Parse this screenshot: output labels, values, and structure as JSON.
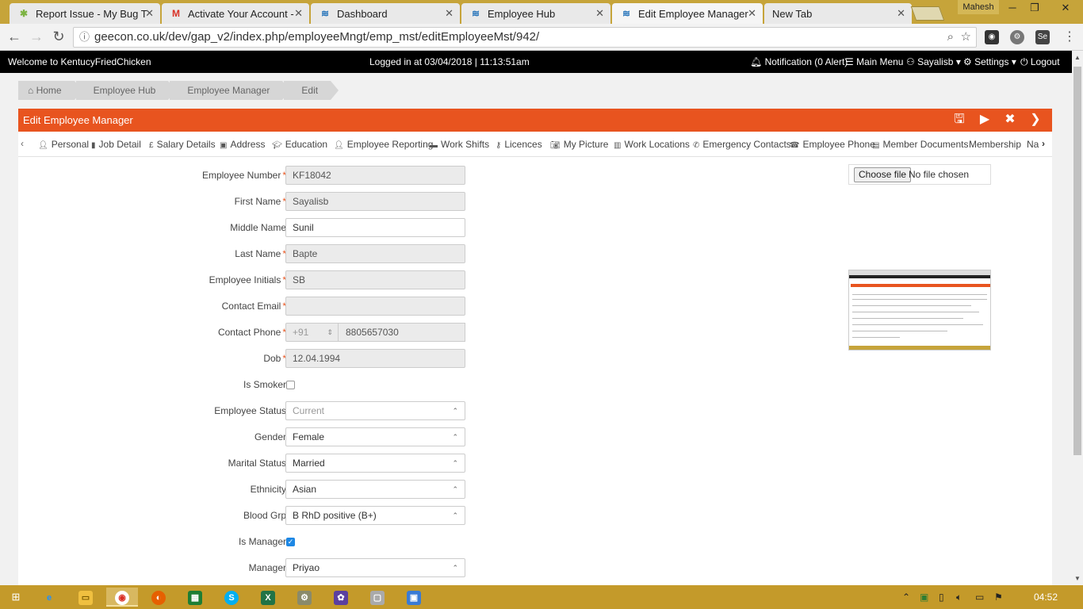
{
  "browser": {
    "tabs": [
      {
        "title": "Report Issue - My Bug Tr",
        "icon": "bug-icon",
        "color": "#7cb342"
      },
      {
        "title": "Activate Your Account -",
        "icon": "gmail-icon",
        "color": "#d93025"
      },
      {
        "title": "Dashboard",
        "icon": "app-favicon-icon",
        "color": "#1e6fb8"
      },
      {
        "title": "Employee Hub",
        "icon": "app-favicon-icon",
        "color": "#1e6fb8"
      },
      {
        "title": "Edit Employee Manager",
        "icon": "app-favicon-icon",
        "color": "#1e6fb8"
      },
      {
        "title": "New Tab",
        "icon": "",
        "color": ""
      }
    ],
    "profile_name": "Mahesh",
    "url": "geecon.co.uk/dev/gap_v2/index.php/employeeMngt/emp_mst/editEmployeeMst/942/"
  },
  "header": {
    "welcome": "Welcome to KentucyFriedChicken",
    "logged_in": "Logged in at 03/04/2018 | 11:13:51am",
    "notification": "Notification (0 Alert)",
    "main_menu": "Main Menu",
    "user": "Sayalisb",
    "settings": "Settings",
    "logout": "Logout"
  },
  "breadcrumb": [
    "Home",
    "Employee Hub",
    "Employee Manager",
    "Edit"
  ],
  "panel": {
    "title": "Edit Employee Manager",
    "accent": "#e8541f"
  },
  "form_tabs": [
    "Personal",
    "Job Detail",
    "Salary Details",
    "Address",
    "Education",
    "Employee Reporting",
    "Work Shifts",
    "Licences",
    "My Picture",
    "Work Locations",
    "Emergency Contacts",
    "Employee Phone",
    "Member Documents",
    "Membership",
    "Na"
  ],
  "form": {
    "employee_number": {
      "label": "Employee Number",
      "value": "KF18042"
    },
    "first_name": {
      "label": "First Name",
      "value": "Sayalisb"
    },
    "middle_name": {
      "label": "Middle Name",
      "value": "Sunil"
    },
    "last_name": {
      "label": "Last Name",
      "value": "Bapte"
    },
    "employee_initials": {
      "label": "Employee Initials",
      "value": "SB"
    },
    "contact_email": {
      "label": "Contact Email",
      "value": ""
    },
    "contact_phone": {
      "label": "Contact Phone",
      "code": "+91",
      "value": "8805657030"
    },
    "dob": {
      "label": "Dob",
      "value": "12.04.1994"
    },
    "is_smoker": {
      "label": "Is Smoker",
      "checked": false
    },
    "employee_status": {
      "label": "Employee Status",
      "value": "Current"
    },
    "gender": {
      "label": "Gender",
      "value": "Female"
    },
    "marital_status": {
      "label": "Marital Status",
      "value": "Married"
    },
    "ethnicity": {
      "label": "Ethnicity",
      "value": "Asian"
    },
    "blood_group": {
      "label": "Blood Grp",
      "value": "B RhD positive (B+)"
    },
    "is_manager": {
      "label": "Is Manager",
      "checked": true
    },
    "manager": {
      "label": "Manager",
      "value": "Priyao"
    }
  },
  "file_upload": {
    "button": "Choose file",
    "status": "No file chosen"
  },
  "taskbar": {
    "time": "04:52"
  }
}
